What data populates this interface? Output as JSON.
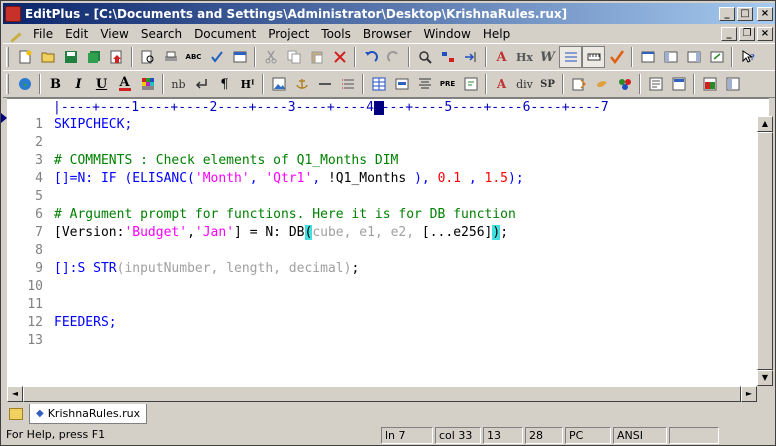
{
  "window": {
    "title": "EditPlus - [C:\\Documents and Settings\\Administrator\\Desktop\\KrishnaRules.rux]"
  },
  "menu": [
    "File",
    "Edit",
    "View",
    "Search",
    "Document",
    "Project",
    "Tools",
    "Browser",
    "Window",
    "Help"
  ],
  "ruler": "|----+----1----+----2----+----3----+----4----+----5----+----6----+----7",
  "editor": {
    "line_numbers": [
      "1",
      "2",
      "3",
      "4",
      "5",
      "6",
      "7",
      "8",
      "9",
      "10",
      "11",
      "12",
      "13"
    ],
    "current_line": "7"
  },
  "code": {
    "l1": "SKIPCHECK;",
    "l3": "# COMMENTS : Check elements of Q1_Months DIM",
    "l4": {
      "a": "[]=N: IF (ELISANC(",
      "b": "'Month'",
      "c": ", ",
      "d": "'Qtr1'",
      "e": ", ",
      "f": "!Q1_Months",
      "g": " ), ",
      "h": "0.1",
      "i": " , ",
      "j": "1.5",
      "k": ");"
    },
    "l6": "# Argument prompt for functions. Here it is for DB function",
    "l7": {
      "a": "[Version:",
      "b": "'Budget'",
      "c": ",",
      "d": "'Jan'",
      "e": "] = N: DB",
      "f": "(",
      "g": "cube, e1, e2, ",
      "h": "[...e256]",
      "i": ")",
      "j": ";"
    },
    "l9": {
      "a": "[]:S STR",
      "b": "(inputNumber, length, decimal)",
      "c": ";"
    },
    "l12": "FEEDERS;"
  },
  "tabs": [
    {
      "label": "KrishnaRules.rux"
    }
  ],
  "status": {
    "help": "For Help, press F1",
    "line": "ln 7",
    "col": "col 33",
    "f3": "13",
    "f4": "28",
    "eol": "PC",
    "encoding": "ANSI"
  },
  "toolbar2_text": {
    "bold": "B",
    "italic": "I",
    "underline": "U",
    "font_color": "A",
    "nbsp": "nb",
    "para": "¶",
    "heading": "Hᴵ",
    "pre": "PRE",
    "div": "div",
    "span": "SP"
  },
  "toolbar1_text": {
    "spell": "ABC",
    "hx": "Hx",
    "word": "W"
  },
  "colors": {
    "keyword": "#0000ff",
    "comment": "#008000",
    "string": "#ff00ff",
    "number": "#ff0000",
    "titlebar_start": "#0a246a"
  }
}
